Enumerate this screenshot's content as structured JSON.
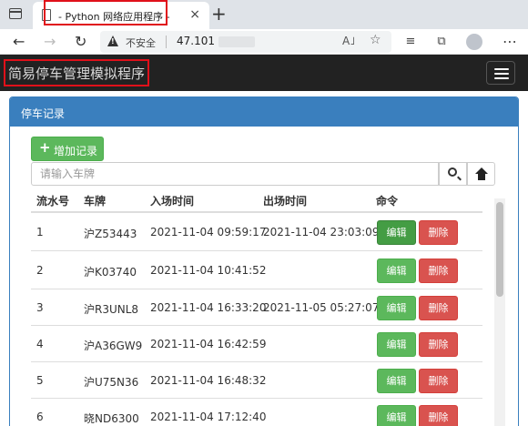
{
  "browser": {
    "tab_title": "- Python 网络应用程序 -",
    "tab_close": "×",
    "new_tab": "+",
    "back": "←",
    "forward": "→",
    "reload": "↻",
    "insecure_label": "不安全",
    "url": "47.101",
    "read_aloud": "A˩",
    "favorite": "☆",
    "more": "⋯"
  },
  "app": {
    "brand": "简易停车管理模拟程序"
  },
  "panel": {
    "title": "停车记录",
    "add_button": "增加记录",
    "search_placeholder": "请输入车牌"
  },
  "table": {
    "headers": [
      "流水号",
      "车牌",
      "入场时间",
      "出场时间",
      "命令"
    ],
    "rows": [
      {
        "id": "1",
        "plate": "沪Z53443",
        "in_time": "2021-11-04 09:59:17",
        "out_time": "2021-11-04 23:03:09",
        "edit": "编辑",
        "delete": "删除"
      },
      {
        "id": "2",
        "plate": "沪K03740",
        "in_time": "2021-11-04 10:41:52",
        "out_time": "",
        "edit": "编辑",
        "delete": "删除"
      },
      {
        "id": "3",
        "plate": "沪R3UNL8",
        "in_time": "2021-11-04 16:33:20",
        "out_time": "2021-11-05 05:27:07",
        "edit": "编辑",
        "delete": "删除"
      },
      {
        "id": "4",
        "plate": "沪A36GW9",
        "in_time": "2021-11-04 16:42:59",
        "out_time": "",
        "edit": "编辑",
        "delete": "删除"
      },
      {
        "id": "5",
        "plate": "沪U75N36",
        "in_time": "2021-11-04 16:48:32",
        "out_time": "",
        "edit": "编辑",
        "delete": "删除"
      },
      {
        "id": "6",
        "plate": "晓ND6300",
        "in_time": "2021-11-04 17:12:40",
        "out_time": "",
        "edit": "编辑",
        "delete": "删除"
      }
    ]
  },
  "colors": {
    "panel_header": "#3a7fbe",
    "success": "#5cb85c",
    "danger": "#d9534f",
    "navbar": "#222222",
    "highlight": "#e0101a"
  }
}
